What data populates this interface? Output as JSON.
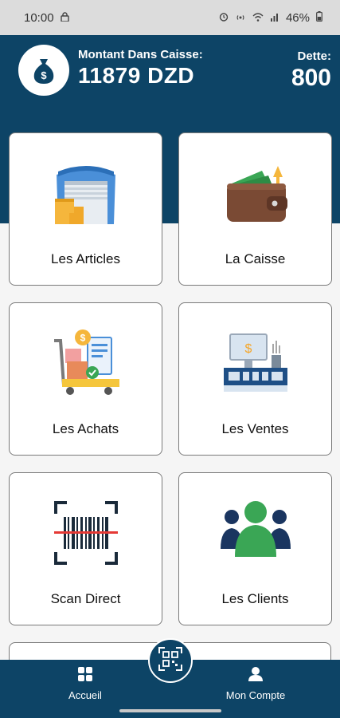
{
  "status_bar": {
    "time": "10:00",
    "battery": "46%",
    "icons": [
      "lock-icon",
      "alarm-icon",
      "hotspot-icon",
      "wifi-icon",
      "signal-icon",
      "battery-icon"
    ]
  },
  "header": {
    "caisse_label": "Montant Dans Caisse:",
    "caisse_amount": "11879 DZD",
    "dette_label": "Dette:",
    "dette_value": "800",
    "icon": "money-bag-icon"
  },
  "cards": [
    {
      "label": "Les Articles",
      "icon": "warehouse-icon"
    },
    {
      "label": "La Caisse",
      "icon": "wallet-icon"
    },
    {
      "label": "Les Achats",
      "icon": "purchase-cart-icon"
    },
    {
      "label": "Les Ventes",
      "icon": "cash-register-icon"
    },
    {
      "label": "Scan Direct",
      "icon": "barcode-scan-icon"
    },
    {
      "label": "Les Clients",
      "icon": "clients-group-icon"
    }
  ],
  "bottom_nav": {
    "home_label": "Accueil",
    "account_label": "Mon Compte",
    "fab_icon": "qr-code-icon"
  },
  "colors": {
    "primary": "#0d4466",
    "card_border": "#7a7a7a",
    "background": "#f5f5f5"
  }
}
